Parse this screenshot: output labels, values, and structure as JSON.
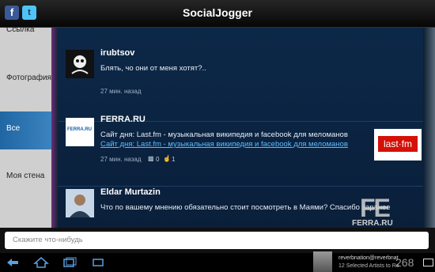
{
  "app": {
    "title": "SocialJogger",
    "facebook_glyph": "f",
    "twitter_glyph": "t"
  },
  "sidebar": {
    "items": [
      {
        "label": "Ссылка"
      },
      {
        "label": "Фотография"
      },
      {
        "label": "Все"
      },
      {
        "label": "Моя стена"
      }
    ]
  },
  "feed": {
    "posts": [
      {
        "author": "irubtsov",
        "text": "Блять, чо они от меня хотят?..",
        "time": "27 мин. назад"
      },
      {
        "author": "FERRA.RU",
        "text": "Сайт дня: Last.fm - музыкальная википедия и facebook для меломанов",
        "link": "Сайт дня: Last.fm - музыкальная википедия и facebook для меломанов",
        "time": "27 мин. назад",
        "comments": "0",
        "likes": "1",
        "thumb_label": "last·fm",
        "avatar_label": "FERRA.RU"
      },
      {
        "author": "Eldar Murtazin",
        "text": "Что по вашему мнению обязательно стоит посмотреть в Маями? Спасибо заранее"
      }
    ]
  },
  "input": {
    "placeholder": "Скажите что-нибудь"
  },
  "notification": {
    "line1": "reverbnation@reverbnat",
    "line2": "12 Selected Artists to Re",
    "count": "268"
  },
  "watermark": "FERRA.RU",
  "colors": {
    "accent": "#1f66a3",
    "link": "#5bbcff",
    "feed_bg": "#0c2848"
  }
}
